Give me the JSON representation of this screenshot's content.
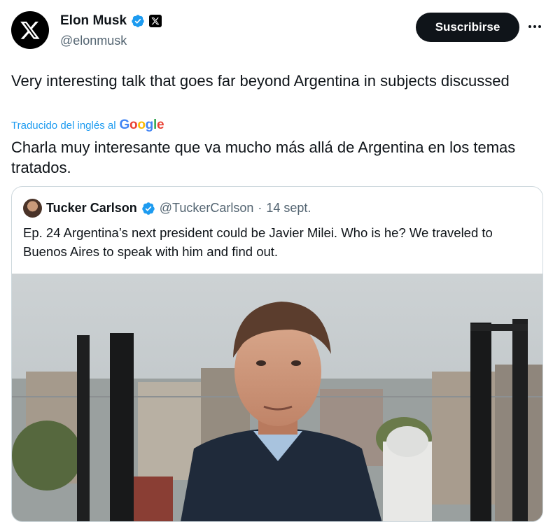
{
  "author": {
    "name": "Elon Musk",
    "handle": "@elonmusk",
    "avatar_icon": "x-logo-icon",
    "verified_icon": "verified-badge-icon",
    "affiliate_icon": "x-affiliate-badge-icon"
  },
  "actions": {
    "subscribe_label": "Suscribirse",
    "more_icon": "more-options-icon"
  },
  "tweet": {
    "text": "Very interesting talk that goes far beyond Argentina in subjects discussed",
    "translated_label": "Traducido del inglés al",
    "translator": "Google",
    "translation": "Charla muy interesante que va mucho más allá de Argentina en los temas tratados."
  },
  "quoted": {
    "name": "Tucker Carlson",
    "handle": "@TuckerCarlson",
    "separator": "·",
    "date": "14 sept.",
    "text": "Ep. 24  Argentina’s next president could be Javier Milei. Who is he? We traveled to Buenos Aires to speak with him and find out.",
    "media": "video-thumbnail"
  },
  "colors": {
    "accent": "#1d9bf0",
    "text": "#0f1419",
    "secondary": "#536471",
    "border": "#cfd9de",
    "button_bg": "#0f1419"
  }
}
